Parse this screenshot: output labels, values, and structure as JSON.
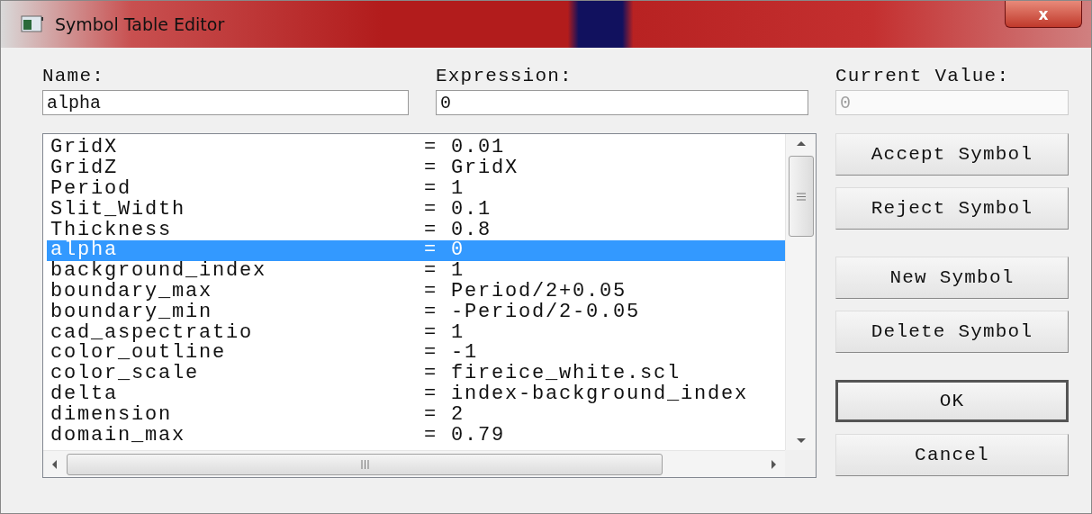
{
  "window": {
    "title": "Symbol Table Editor",
    "close": "x"
  },
  "fields": [
    {
      "label": "Name:",
      "value": "alpha",
      "disabled": false
    },
    {
      "label": "Expression:",
      "value": "0",
      "disabled": false
    },
    {
      "label": "Current Value:",
      "value": "0",
      "disabled": true
    }
  ],
  "symbols": [
    {
      "name": "GridX",
      "value": "= 0.01",
      "selected": false
    },
    {
      "name": "GridZ",
      "value": "= GridX",
      "selected": false
    },
    {
      "name": "Period",
      "value": "= 1",
      "selected": false
    },
    {
      "name": "Slit_Width",
      "value": "= 0.1",
      "selected": false
    },
    {
      "name": "Thickness",
      "value": "= 0.8",
      "selected": false
    },
    {
      "name": "alpha",
      "value": "= 0",
      "selected": true
    },
    {
      "name": "background_index",
      "value": "= 1",
      "selected": false
    },
    {
      "name": "boundary_max",
      "value": "= Period/2+0.05",
      "selected": false
    },
    {
      "name": "boundary_min",
      "value": "= -Period/2-0.05",
      "selected": false
    },
    {
      "name": "cad_aspectratio",
      "value": "= 1",
      "selected": false
    },
    {
      "name": "color_outline",
      "value": "= -1",
      "selected": false
    },
    {
      "name": "color_scale",
      "value": "= fireice_white.scl",
      "selected": false
    },
    {
      "name": "delta",
      "value": "= index-background_index",
      "selected": false
    },
    {
      "name": "dimension",
      "value": "= 2",
      "selected": false
    },
    {
      "name": "domain_max",
      "value": "= 0.79",
      "selected": false
    }
  ],
  "button_groups": [
    [
      {
        "label": "Accept Symbol",
        "default": false
      },
      {
        "label": "Reject Symbol",
        "default": false
      }
    ],
    [
      {
        "label": "New Symbol",
        "default": false
      },
      {
        "label": "Delete Symbol",
        "default": false
      }
    ],
    [
      {
        "label": "OK",
        "default": true
      },
      {
        "label": "Cancel",
        "default": false
      }
    ]
  ]
}
